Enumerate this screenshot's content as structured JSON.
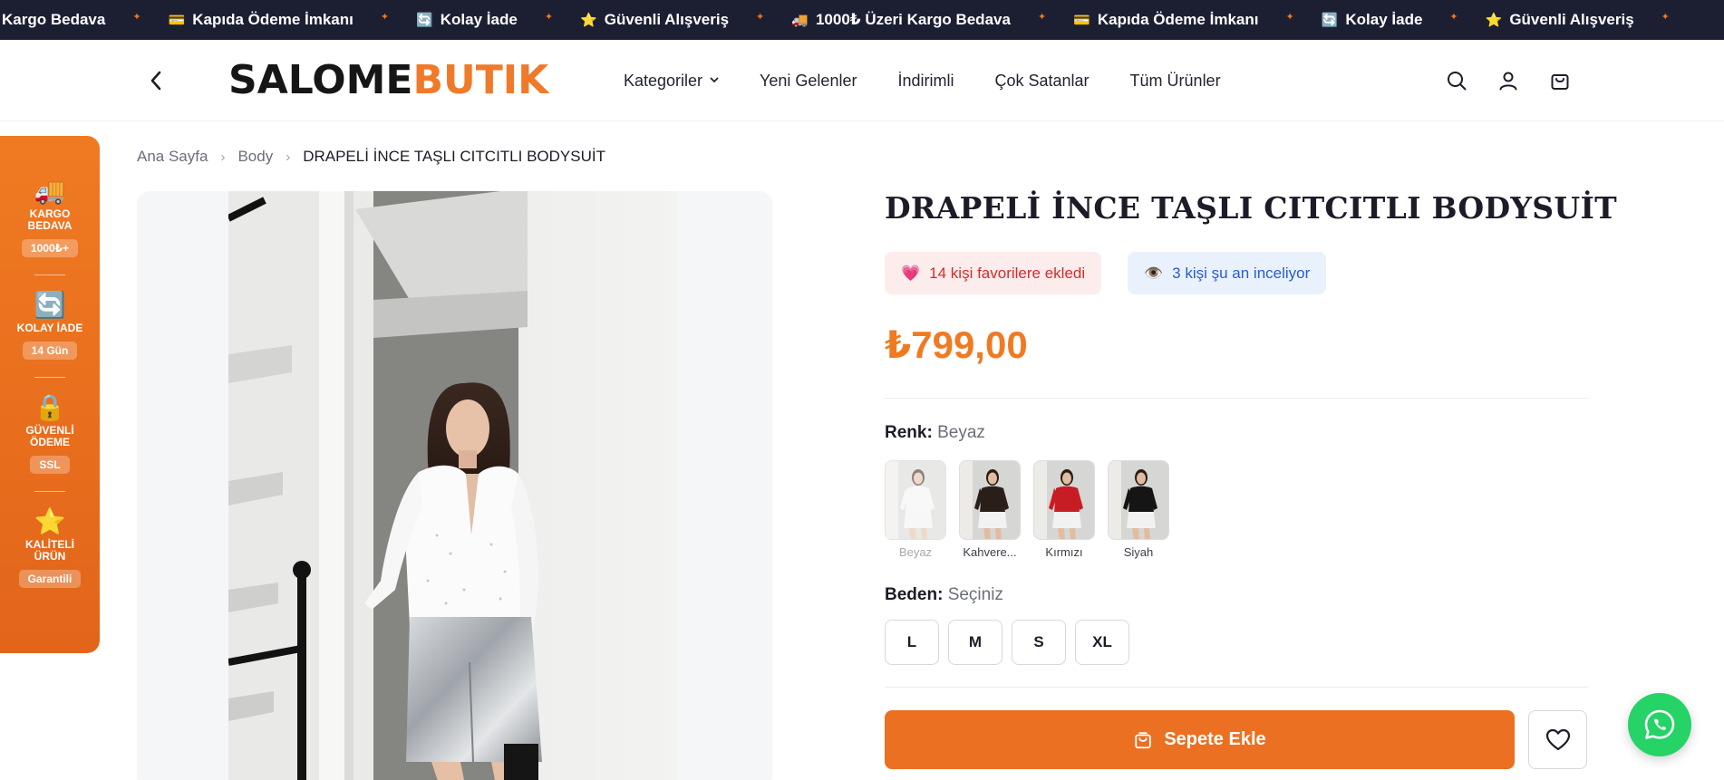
{
  "announcement": {
    "items": [
      {
        "icon": "",
        "text": "Kargo Bedava"
      },
      {
        "icon": "💳",
        "text": "Kapıda Ödeme İmkanı"
      },
      {
        "icon": "🔄",
        "text": "Kolay İade"
      },
      {
        "icon": "⭐",
        "text": "Güvenli Alışveriş"
      },
      {
        "icon": "🚚",
        "text": "1000₺ Üzeri Kargo Bedava"
      },
      {
        "icon": "💳",
        "text": "Kapıda Ödeme İmkanı"
      },
      {
        "icon": "🔄",
        "text": "Kolay İade"
      },
      {
        "icon": "⭐",
        "text": "Güvenli Alışveriş"
      }
    ],
    "separator": "✦"
  },
  "header": {
    "logo_part1": "SALOME",
    "logo_part2": "BUTIK",
    "nav": [
      {
        "label": "Kategoriler",
        "has_dropdown": true
      },
      {
        "label": "Yeni Gelenler"
      },
      {
        "label": "İndirimli"
      },
      {
        "label": "Çok Satanlar"
      },
      {
        "label": "Tüm Ürünler"
      }
    ]
  },
  "trust_panel": [
    {
      "icon": "🚚",
      "title": "KARGO BEDAVA",
      "badge": "1000₺+"
    },
    {
      "icon": "🔄",
      "title": "KOLAY İADE",
      "badge": "14 Gün"
    },
    {
      "icon": "🔒",
      "title": "GÜVENLİ ÖDEME",
      "badge": "SSL"
    },
    {
      "icon": "⭐",
      "title": "KALİTELİ ÜRÜN",
      "badge": "Garantili"
    }
  ],
  "breadcrumb": [
    "Ana Sayfa",
    "Body",
    "DRAPELİ İNCE TAŞLI CITCITLI BODYSUİT"
  ],
  "product": {
    "title": "DRAPELİ İNCE TAŞLI CITCITLI BODYSUİT",
    "fav_icon": "💗",
    "fav_text": "14 kişi favorilere ekledi",
    "view_icon": "👁️",
    "view_text": "3 kişi şu an inceliyor",
    "price": "₺799,00",
    "color_label": "Renk:",
    "color_value": "Beyaz",
    "colors": [
      {
        "name": "Beyaz",
        "top": "#f4f4f4",
        "selected": true
      },
      {
        "name": "Kahverengi",
        "display": "Kahvere...",
        "top": "#2a1e19"
      },
      {
        "name": "Kırmızı",
        "top": "#c71c23"
      },
      {
        "name": "Siyah",
        "top": "#151515"
      }
    ],
    "size_label": "Beden:",
    "size_value": "Seçiniz",
    "sizes": [
      "L",
      "M",
      "S",
      "XL"
    ],
    "add_to_cart": "Sepete Ekle"
  },
  "colors": {
    "accent": "#f07a22",
    "announcement_bg": "#1c1f32",
    "whatsapp": "#25d366"
  }
}
